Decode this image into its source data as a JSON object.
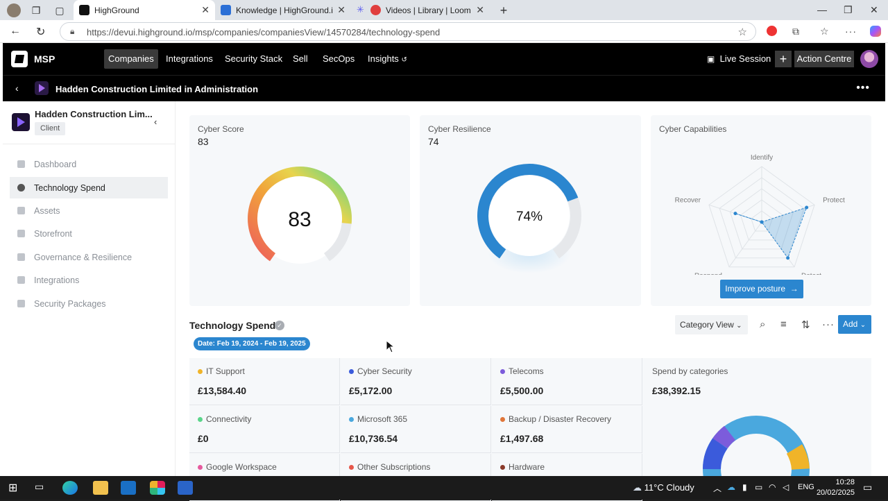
{
  "browser": {
    "tabs": [
      {
        "title": "HighGround",
        "active": true
      },
      {
        "title": "Knowledge | HighGround.io | Inte"
      },
      {
        "title": "Videos | Library | Loom"
      }
    ],
    "url": "https://devui.highground.io/msp/companies/companiesView/14570284/technology-spend"
  },
  "header": {
    "brand": "MSP",
    "nav": [
      {
        "label": "Companies",
        "active": true
      },
      {
        "label": "Integrations"
      },
      {
        "label": "Security Stack"
      },
      {
        "label": "Sell"
      },
      {
        "label": "SecOps"
      },
      {
        "label": "Insights"
      }
    ],
    "live_session": "Live Session",
    "action_centre": "Action Centre"
  },
  "subheader": {
    "company": "Hadden Construction Limited in Administration"
  },
  "sidebar": {
    "company": "Hadden Construction Lim...",
    "badge": "Client",
    "items": [
      {
        "label": "Dashboard"
      },
      {
        "label": "Technology Spend",
        "active": true
      },
      {
        "label": "Assets"
      },
      {
        "label": "Storefront"
      },
      {
        "label": "Governance & Resilience"
      },
      {
        "label": "Integrations"
      },
      {
        "label": "Security Packages"
      }
    ]
  },
  "cards": {
    "score": {
      "title": "Cyber Score",
      "value": "83",
      "center": "83",
      "fraction": 0.83
    },
    "resilience": {
      "title": "Cyber Resilience",
      "value": "74",
      "center": "74%",
      "fraction": 0.74
    },
    "capabilities": {
      "title": "Cyber Capabilities",
      "axes": [
        "Identify",
        "Protect",
        "Detect",
        "Respond",
        "Recover"
      ],
      "values": [
        0.0,
        0.85,
        0.8,
        0.0,
        0.5
      ],
      "button": "Improve posture"
    }
  },
  "tech_spend": {
    "title": "Technology Spend",
    "date": "Date: Feb 19, 2024 - Feb 19, 2025",
    "view": "Category View",
    "add": "Add",
    "categories": [
      {
        "name": "IT Support",
        "value": "£13,584.40",
        "color": "#f0b429"
      },
      {
        "name": "Cyber Security",
        "value": "£5,172.00",
        "color": "#3b5bdb"
      },
      {
        "name": "Telecoms",
        "value": "£5,500.00",
        "color": "#7c5cdb"
      },
      {
        "name": "Connectivity",
        "value": "£0",
        "color": "#5ad58a"
      },
      {
        "name": "Microsoft 365",
        "value": "£10,736.54",
        "color": "#4aa8de"
      },
      {
        "name": "Backup / Disaster Recovery",
        "value": "£1,497.68",
        "color": "#e0763a"
      },
      {
        "name": "Google Workspace",
        "value": "",
        "color": "#e65a9e"
      },
      {
        "name": "Other Subscriptions",
        "value": "",
        "color": "#e6574a"
      },
      {
        "name": "Hardware",
        "value": "",
        "color": "#8a3a2a"
      }
    ],
    "spend_title": "Spend by categories",
    "spend_total": "£38,392.15"
  },
  "taskbar": {
    "weather": "11°C  Cloudy",
    "lang": "ENG",
    "time": "10:28",
    "date": "20/02/2025"
  }
}
